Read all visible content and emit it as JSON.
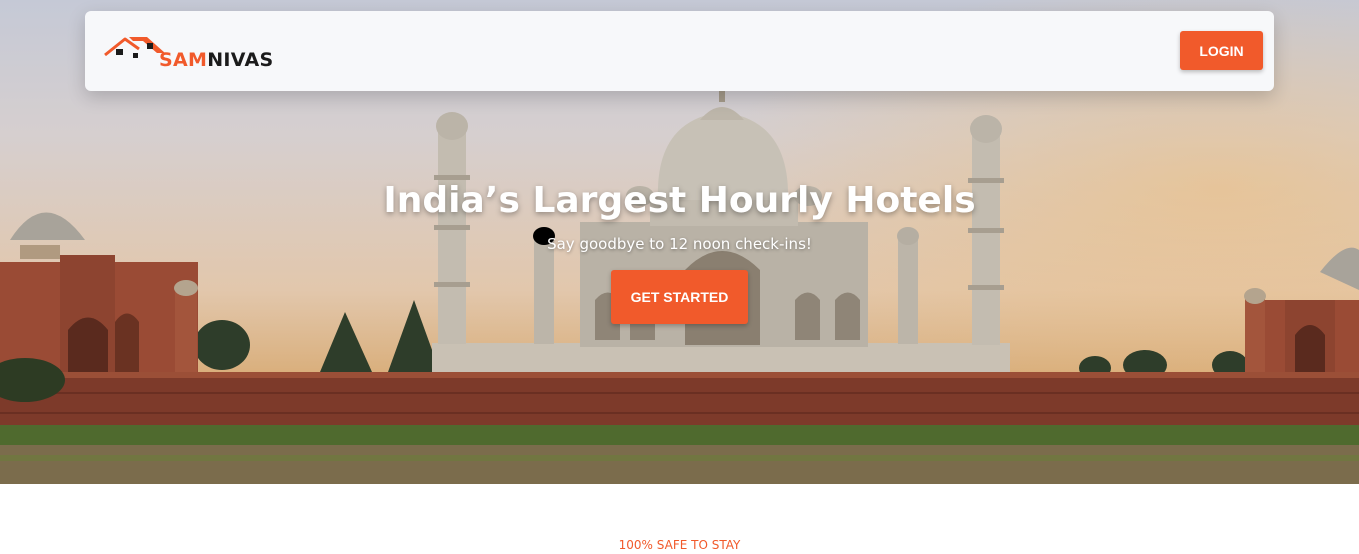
{
  "brand": {
    "name_part1": "SAM",
    "name_part2": "NIVAS",
    "accent_color": "#f15a2b"
  },
  "navbar": {
    "login_label": "LOGIN"
  },
  "hero": {
    "title": "India’s Largest Hourly Hotels",
    "subtitle": "Say goodbye to 12 noon check-ins!",
    "cta_label": "GET STARTED",
    "background": "taj-mahal-photo"
  },
  "section": {
    "label": "100% SAFE TO STAY"
  },
  "icons": {
    "logo": "house-roof-logo-icon"
  }
}
